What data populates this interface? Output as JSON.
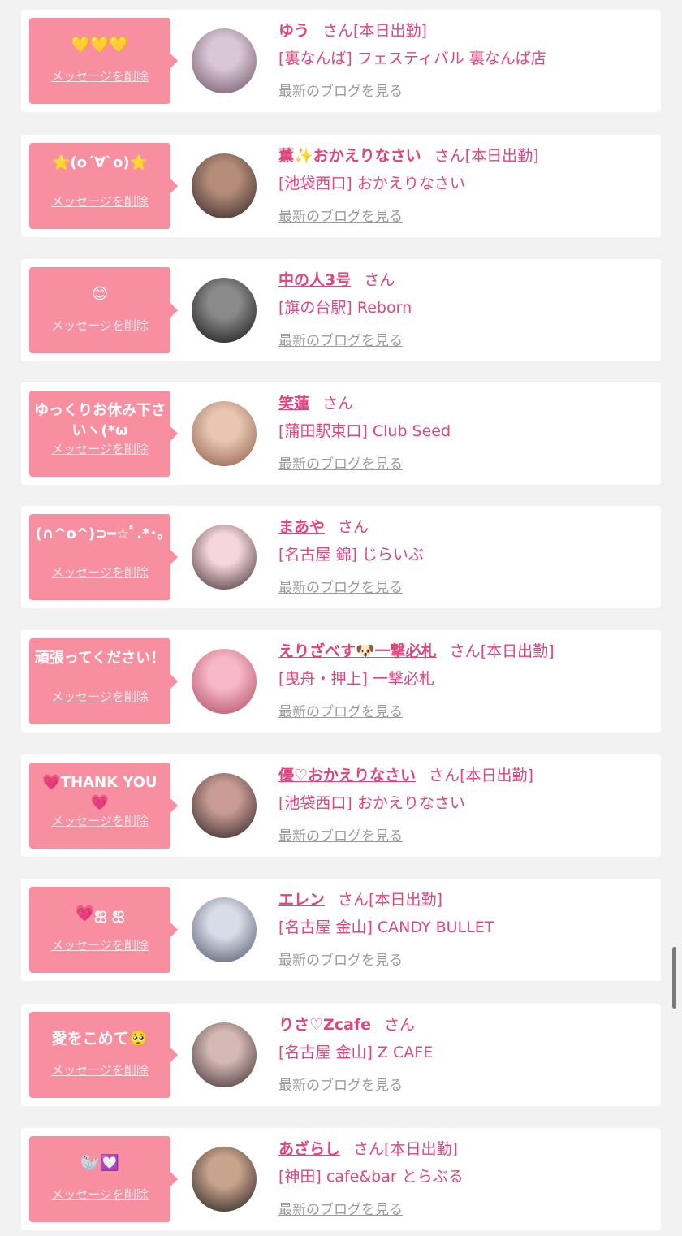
{
  "delete_label": "メッセージを削除",
  "blog_label": "最新のブログを見る",
  "honorific": "さん",
  "cards": [
    {
      "message": "💛💛💛",
      "name": "ゆう",
      "status": "[本日出勤]",
      "shop": "[裏なんば] フェスティバル 裏なんば店",
      "avatar_colors": [
        "#d9c7d6",
        "#6b4f62"
      ]
    },
    {
      "message": "⭐️(o´∀`o)⭐️",
      "name": "薫✨おかえりなさい",
      "status": "[本日出勤]",
      "shop": "[池袋西口] おかえりなさい",
      "avatar_colors": [
        "#b48c78",
        "#2e2426"
      ]
    },
    {
      "message": "😊",
      "name": "中の人3号",
      "status": "",
      "shop": "[旗の台駅] Reborn",
      "avatar_colors": [
        "#8a8a8a",
        "#111111"
      ]
    },
    {
      "message": "ゆっくりお休み下さいヽ(*ω",
      "name": "笑蓮",
      "status": "",
      "shop": "[蒲田駅東口] Club Seed",
      "avatar_colors": [
        "#e8c6b2",
        "#8a5a44"
      ]
    },
    {
      "message": "(∩^o^)⊃━☆ﾟ.*･｡",
      "name": "まあや",
      "status": "",
      "shop": "[名古屋 錦] じらいぶ",
      "avatar_colors": [
        "#f4d6dc",
        "#3c2a2e"
      ]
    },
    {
      "message": "頑張ってください！",
      "name": "えりざべす🐶一撃必札",
      "status": "[本日出勤]",
      "shop": "[曳舟・押上] 一撃必札",
      "avatar_colors": [
        "#f6b8c8",
        "#b0465c"
      ]
    },
    {
      "message": "💗THANK YOU💗",
      "name": "優♡おかえりなさい",
      "status": "[本日出勤]",
      "shop": "[池袋西口] おかえりなさい",
      "avatar_colors": [
        "#c89c94",
        "#2a1e20"
      ]
    },
    {
      "message": "💗ஐ ஐ",
      "name": "エレン",
      "status": "[本日出勤]",
      "shop": "[名古屋 金山] CANDY BULLET",
      "avatar_colors": [
        "#d8dce8",
        "#4a5266"
      ]
    },
    {
      "message": "愛をこめて🥺",
      "name": "りさ♡Zcafe",
      "status": "",
      "shop": "[名古屋 金山] Z CAFE",
      "avatar_colors": [
        "#d4b8b4",
        "#3a2c2e"
      ]
    },
    {
      "message": "🦭💟",
      "name": "あざらし",
      "status": "[本日出勤]",
      "shop": "[神田] cafe&bar とらぶる",
      "avatar_colors": [
        "#c9a48c",
        "#1e1a1c"
      ]
    }
  ]
}
